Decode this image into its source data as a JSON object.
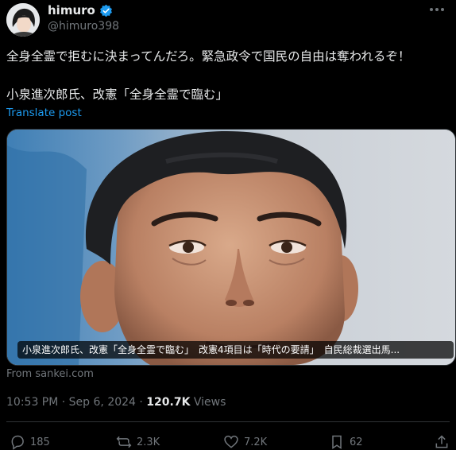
{
  "author": {
    "name": "himuro",
    "handle": "@himuro398"
  },
  "tweet": {
    "text_line1": "全身全霊で拒むに決まってんだろ。緊急政令で国民の自由は奪われるぞ！",
    "text_line2": "小泉進次郎氏、改憲「全身全霊で臨む」",
    "translate_label": "Translate post"
  },
  "media": {
    "caption": "小泉進次郎氏、改憲「全身全霊で臨む」　改憲4項目は「時代の要請」　自民総裁選出馬...",
    "source": "From sankei.com"
  },
  "meta": {
    "timestamp": "10:53 PM · Sep 6, 2024 · ",
    "views_count": "120.7K",
    "views_label": " Views"
  },
  "actions": {
    "replies": "185",
    "reposts": "2.3K",
    "likes": "7.2K",
    "bookmarks": "62"
  },
  "colors": {
    "background": "#000000",
    "text": "#e7e9ea",
    "muted": "#71767b",
    "link": "#1d9bf0",
    "border": "#2f3336"
  }
}
